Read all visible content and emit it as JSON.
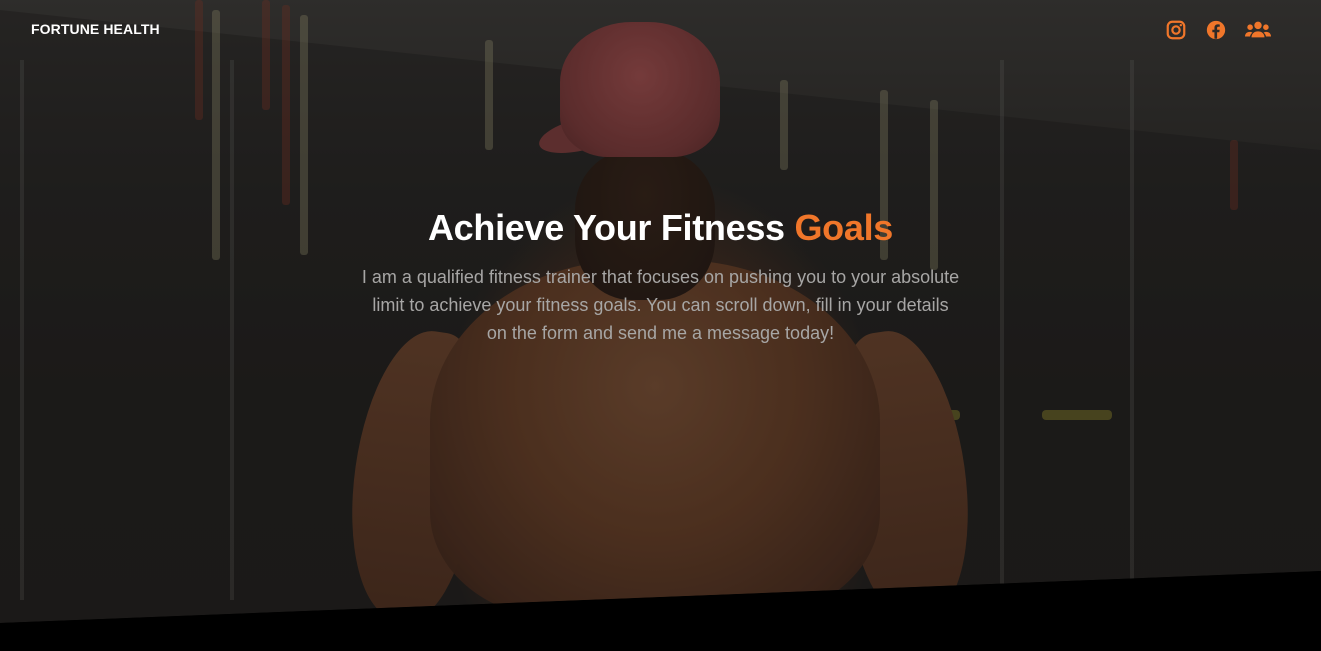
{
  "brand": {
    "name": "FORTUNE HEALTH"
  },
  "nav": {
    "social": [
      {
        "name": "instagram",
        "icon": "instagram-icon"
      },
      {
        "name": "facebook",
        "icon": "facebook-icon"
      },
      {
        "name": "community",
        "icon": "users-icon"
      }
    ]
  },
  "hero": {
    "title_main": "Achieve Your Fitness ",
    "title_accent": "Goals",
    "description": "I am a qualified fitness trainer that focuses on pushing you to your absolute limit to achieve your fitness goals. You can scroll down, fill in your details on the form and send me a message today!"
  },
  "colors": {
    "accent": "#f0762a",
    "text_primary": "#ffffff",
    "text_muted": "#a7a6a5",
    "background": "#000000"
  }
}
